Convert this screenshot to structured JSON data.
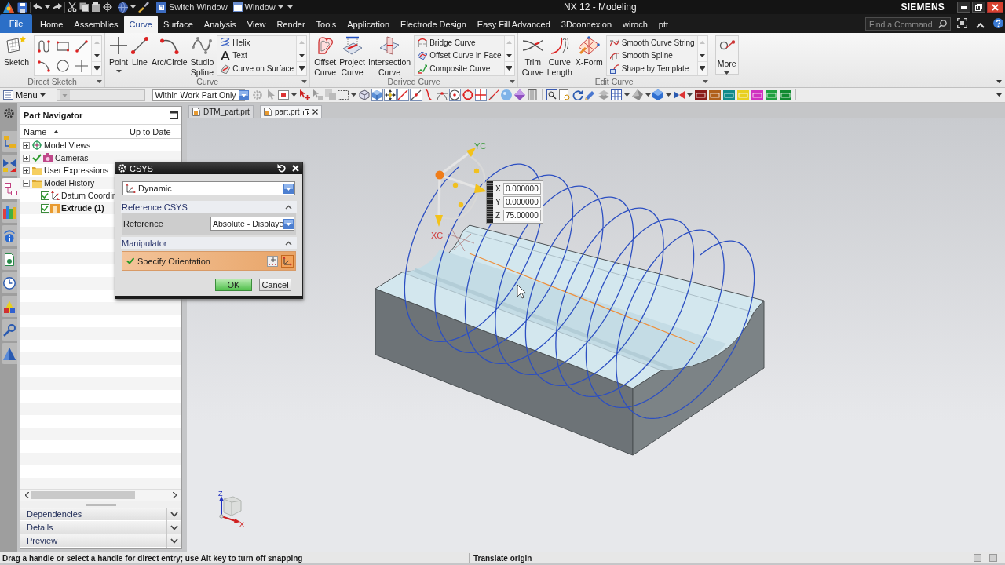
{
  "title_bar": {
    "commands": [
      {
        "label": "Switch Window"
      },
      {
        "label": "Window",
        "dropdown": true
      }
    ],
    "title": "NX 12 - Modeling",
    "brand": "SIEMENS"
  },
  "ribbon_tabs": [
    {
      "label": "File",
      "kind": "file",
      "selected": false
    },
    {
      "label": "Home",
      "kind": "tab",
      "selected": false
    },
    {
      "label": "Assemblies",
      "kind": "tab",
      "selected": false
    },
    {
      "label": "Curve",
      "kind": "tab",
      "selected": true
    },
    {
      "label": "Surface",
      "kind": "tab",
      "selected": false
    },
    {
      "label": "Analysis",
      "kind": "tab",
      "selected": false
    },
    {
      "label": "View",
      "kind": "tab",
      "selected": false
    },
    {
      "label": "Render",
      "kind": "tab",
      "selected": false
    },
    {
      "label": "Tools",
      "kind": "tab",
      "selected": false
    },
    {
      "label": "Application",
      "kind": "tab",
      "selected": false
    },
    {
      "label": "Electrode Design",
      "kind": "tab",
      "selected": false
    },
    {
      "label": "Easy Fill Advanced",
      "kind": "tab",
      "selected": false
    },
    {
      "label": "3Dconnexion",
      "kind": "tab",
      "selected": false
    },
    {
      "label": "wiroch",
      "kind": "tab",
      "selected": false
    },
    {
      "label": "ptt",
      "kind": "tab",
      "selected": false
    }
  ],
  "command_finder": {
    "placeholder": "Find a Command"
  },
  "ribbon_groups": [
    {
      "label": "Direct Sketch",
      "gallery": true,
      "buttons": [
        {
          "label": "Sketch"
        }
      ]
    },
    {
      "label": "Curve",
      "buttons": [
        {
          "label": "Point",
          "dropdown": true
        },
        {
          "label": "Line"
        },
        {
          "label": "Arc/Circle"
        },
        {
          "label": "Studio Spline"
        }
      ],
      "list": [
        "Helix",
        "Text",
        "Curve on Surface"
      ]
    },
    {
      "label": "Derived Curve",
      "buttons": [
        {
          "label": "Offset Curve"
        },
        {
          "label": "Project Curve"
        },
        {
          "label": "Intersection Curve"
        }
      ],
      "list": [
        "Bridge Curve",
        "Offset Curve in Face",
        "Composite Curve"
      ]
    },
    {
      "label": "Edit Curve",
      "buttons": [
        {
          "label": "Trim Curve"
        },
        {
          "label": "Curve Length"
        },
        {
          "label": "X-Form"
        }
      ],
      "list": [
        "Smooth Curve String",
        "Smooth Spline",
        "Shape by Template"
      ]
    },
    {
      "buttons": [
        {
          "label": "More",
          "dropdown": true
        }
      ]
    }
  ],
  "toolbar": {
    "menu": "Menu",
    "type_filter": {
      "disabled": true
    },
    "scope_filter": {
      "value": "Within Work Part Only"
    },
    "snap_toggles": [
      {
        "on": false
      },
      {
        "on": true
      },
      {
        "on": true
      },
      {
        "on": true
      },
      {
        "on": true
      },
      {
        "on": false
      },
      {
        "on": false
      },
      {
        "on": true
      },
      {
        "on": false
      },
      {
        "on": true
      },
      {
        "on": false
      },
      {
        "on": false
      },
      {
        "on": false
      },
      {
        "on": false
      }
    ]
  },
  "resource_tabs": [
    {
      "selected": false
    },
    {
      "selected": false
    },
    {
      "selected": true
    },
    {
      "selected": false
    },
    {
      "selected": false
    },
    {
      "selected": false
    },
    {
      "selected": false
    },
    {
      "selected": false
    },
    {
      "selected": false
    },
    {
      "selected": false
    }
  ],
  "part_navigator": {
    "title": "Part Navigator",
    "columns": [
      {
        "label": "Name",
        "sorted": true
      },
      {
        "label": "Up to Date",
        "sorted": false
      }
    ],
    "nodes": [
      {
        "label": "Model Views",
        "kind": "views",
        "expanded": false
      },
      {
        "label": "Cameras",
        "kind": "cameras",
        "expanded": false
      },
      {
        "label": "User Expressions",
        "kind": "folder",
        "expanded": false
      },
      {
        "label": "Model History",
        "kind": "folder",
        "expanded": true,
        "children": [
          {
            "label": "Datum Coordin",
            "kind": "datum",
            "checked": true,
            "current": false
          },
          {
            "label": "Extrude (1)",
            "kind": "extrude",
            "checked": true,
            "current": true
          }
        ]
      }
    ],
    "sections": [
      {
        "label": "Dependencies",
        "expanded": false
      },
      {
        "label": "Details",
        "expanded": false
      },
      {
        "label": "Preview",
        "expanded": false
      }
    ]
  },
  "graphics_tabs": [
    {
      "label": "DTM_part.prt",
      "selected": false
    },
    {
      "label": "part.prt",
      "selected": true
    }
  ],
  "viewport": {
    "manipulator_labels": [
      "YC",
      "XC"
    ],
    "coordinate_entry": [
      {
        "axis": "X",
        "value": "0.000000"
      },
      {
        "axis": "Y",
        "value": "0.000000"
      },
      {
        "axis": "Z",
        "value": "75.00000"
      }
    ],
    "triad_labels": [
      "Z",
      "X"
    ]
  },
  "csys_dialog": {
    "title": "CSYS",
    "type": "Dynamic",
    "sections": [
      {
        "label": "Reference CSYS",
        "expanded": true,
        "rows": [
          {
            "kind": "dropdown",
            "label": "Reference",
            "value": "Absolute - Displaye"
          }
        ]
      },
      {
        "label": "Manipulator",
        "expanded": true,
        "rows": [
          {
            "kind": "selection",
            "label": "Specify Orientation",
            "complete": true,
            "selected": true
          }
        ]
      }
    ],
    "buttons": [
      {
        "label": "OK",
        "kind": "default"
      },
      {
        "label": "Cancel",
        "kind": "normal"
      }
    ]
  },
  "status_bar": {
    "prompt": "Drag a handle or select a handle for direct entry; use Alt key to turn off snapping",
    "message": "Translate origin"
  }
}
